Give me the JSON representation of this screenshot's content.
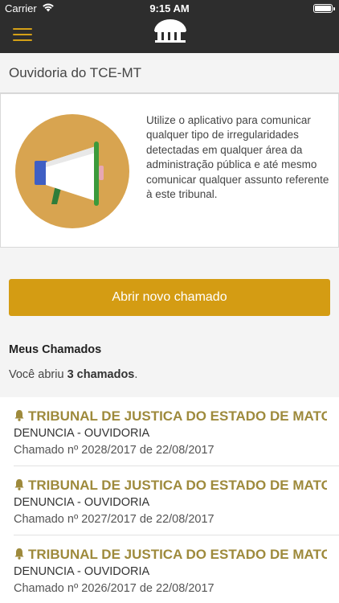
{
  "status_bar": {
    "carrier": "Carrier",
    "time": "9:15 AM"
  },
  "navbar": {
    "menu_icon": "hamburger-menu-icon",
    "logo_icon": "tce-building-logo-icon",
    "accent": "#d4a017",
    "background": "#2d2d2d"
  },
  "page": {
    "title": "Ouvidoria do TCE-MT"
  },
  "intro": {
    "illustration": "megaphone-icon",
    "text": "Utilize o aplicativo para comunicar qualquer tipo de irregularidades detectadas em qualquer área da administração pública e até mesmo comunicar qualquer assunto referente à este tribunal."
  },
  "actions": {
    "open_button_label": "Abrir novo chamado",
    "button_color": "#d49c13"
  },
  "my_tickets": {
    "title": "Meus Chamados",
    "count_prefix": "Você abriu ",
    "count_value": "3 chamados",
    "count_suffix": "."
  },
  "tickets": [
    {
      "icon": "bell-icon",
      "title": "TRIBUNAL DE JUSTICA DO ESTADO DE MATO GROSSO",
      "type": "DENUNCIA - OUVIDORIA",
      "date": "Chamado nº 2028/2017 de 22/08/2017"
    },
    {
      "icon": "bell-icon",
      "title": "TRIBUNAL DE JUSTICA DO ESTADO DE MATO GROSSO",
      "type": "DENUNCIA - OUVIDORIA",
      "date": "Chamado nº 2027/2017 de 22/08/2017"
    },
    {
      "icon": "bell-icon",
      "title": "TRIBUNAL DE JUSTICA DO ESTADO DE MATO GROSSO",
      "type": "DENUNCIA - OUVIDORIA",
      "date": "Chamado nº 2026/2017 de 22/08/2017"
    }
  ],
  "colors": {
    "ticket_title": "#9e8a3c"
  }
}
